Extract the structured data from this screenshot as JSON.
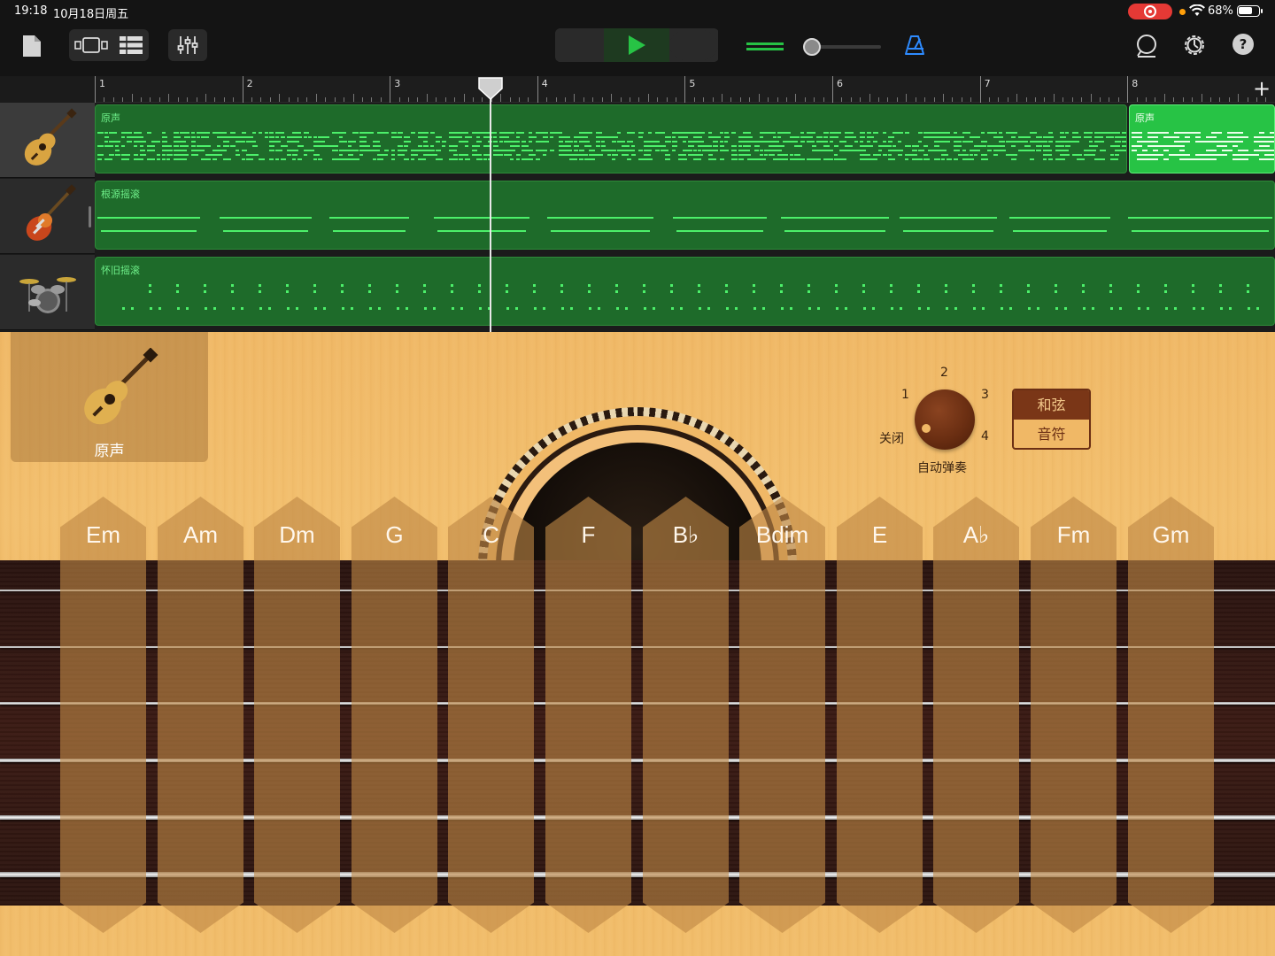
{
  "status_bar": {
    "time": "19:18",
    "date": "10月18日周五",
    "battery": "68%"
  },
  "toolbar": {
    "icons": [
      "document-icon",
      "tracks-view-icon",
      "list-view-icon",
      "mixer-icon",
      "stop-icon",
      "play-icon",
      "record-icon",
      "volume-icon",
      "metronome-icon",
      "loop-icon",
      "settings-icon",
      "help-icon"
    ],
    "help_label": "?",
    "master_volume": 0.05,
    "colors": {
      "play": "#27c345",
      "record": "#ff3b30",
      "metronome": "#2e8bff"
    }
  },
  "ruler": {
    "bars": [
      "1",
      "2",
      "3",
      "4",
      "5",
      "6",
      "7",
      "8"
    ],
    "add_label": "+"
  },
  "tracks": [
    {
      "instrument": "acoustic-guitar-icon",
      "region_labels": [
        "原声",
        "原声"
      ],
      "selected": true
    },
    {
      "instrument": "electric-guitar-icon",
      "region_labels": [
        "根源摇滚"
      ]
    },
    {
      "instrument": "drum-kit-icon",
      "region_labels": [
        "怀旧摇滚"
      ]
    }
  ],
  "instrument": {
    "name": "原声",
    "autoplay": {
      "label": "自动弹奏",
      "off_label": "关闭",
      "positions": [
        "1",
        "2",
        "3",
        "4"
      ],
      "value": "关闭"
    },
    "mode": {
      "chords": "和弦",
      "notes": "音符",
      "selected": "和弦"
    },
    "chords": [
      "Em",
      "Am",
      "Dm",
      "G",
      "C",
      "F",
      "B♭",
      "Bdim",
      "E",
      "A♭",
      "Fm",
      "Gm"
    ],
    "colors": {
      "body": "#f0b866",
      "fretboard": "#3b1b14",
      "region": "#1e6b2a",
      "region_selected": "#27c345"
    }
  }
}
